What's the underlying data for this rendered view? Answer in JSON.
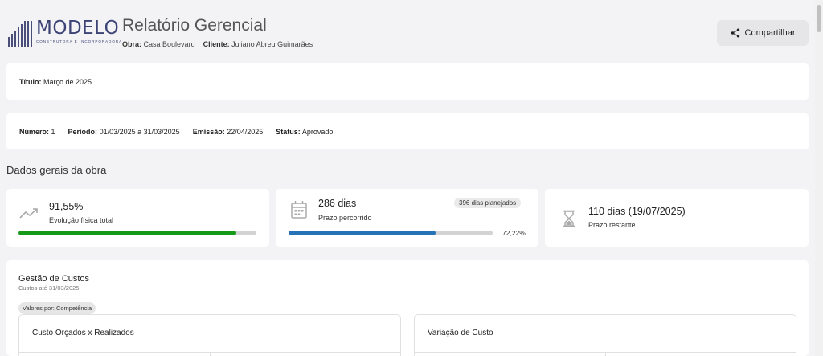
{
  "brand": {
    "name": "MODELO",
    "tagline": "CONSTRUTORA E INCORPORADORA"
  },
  "header": {
    "title": "Relatório Gerencial",
    "obra_label": "Obra:",
    "obra_value": "Casa Boulevard",
    "cliente_label": "Cliente:",
    "cliente_value": "Juliano Abreu Guimarães",
    "share_label": "Compartilhar"
  },
  "report_title": {
    "label": "Título:",
    "value": "Março de 2025"
  },
  "report_info": {
    "numero_label": "Número:",
    "numero_value": "1",
    "periodo_label": "Período:",
    "periodo_value": "01/03/2025 a 31/03/2025",
    "emissao_label": "Emissão:",
    "emissao_value": "22/04/2025",
    "status_label": "Status:",
    "status_value": "Aprovado"
  },
  "section": {
    "title": "Dados gerais da obra"
  },
  "stats": {
    "physical": {
      "icon": "trending-up-icon",
      "value": "91,55%",
      "label": "Evolução física total",
      "progress": 0.9155,
      "color": "#179a18"
    },
    "elapsed": {
      "icon": "calendar-icon",
      "value": "286 dias",
      "label": "Prazo percorrido",
      "badge": "396 dias planejados",
      "progress": 0.7222,
      "percent_text": "72,22%",
      "color": "#2673b8"
    },
    "remaining": {
      "icon": "hourglass-icon",
      "value": "110 dias (19/07/2025)",
      "label": "Prazo restante"
    }
  },
  "costs": {
    "title": "Gestão de Custos",
    "subtitle": "Custos até 31/03/2025",
    "values_badge": "Valores por: Competência",
    "left_card_title": "Custo Orçados x Realizados",
    "right_card_title": "Variação de Custo"
  }
}
